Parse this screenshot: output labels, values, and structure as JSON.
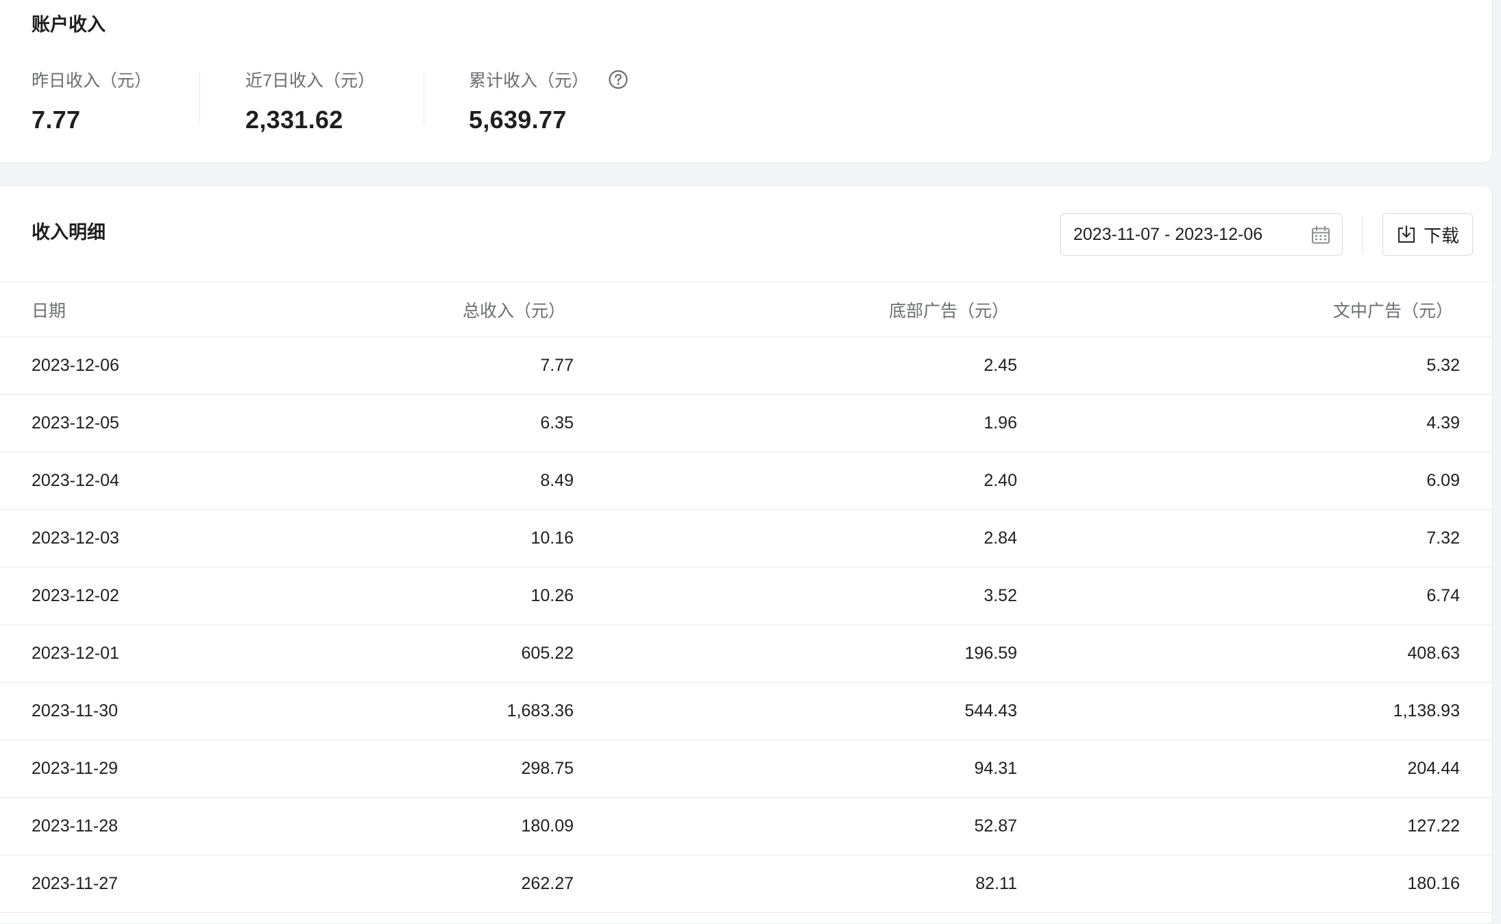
{
  "account": {
    "title": "账户收入",
    "metrics": [
      {
        "label": "昨日收入（元）",
        "value": "7.77"
      },
      {
        "label": "近7日收入（元）",
        "value": "2,331.62"
      },
      {
        "label": "累计收入（元）",
        "value": "5,639.77",
        "icon": "help-circle-icon"
      }
    ]
  },
  "detail": {
    "title": "收入明细",
    "date_range": "2023-11-07 - 2023-12-06",
    "download_label": "下载",
    "columns": [
      "日期",
      "总收入（元）",
      "底部广告（元）",
      "文中广告（元）"
    ],
    "rows": [
      [
        "2023-12-06",
        "7.77",
        "2.45",
        "5.32"
      ],
      [
        "2023-12-05",
        "6.35",
        "1.96",
        "4.39"
      ],
      [
        "2023-12-04",
        "8.49",
        "2.40",
        "6.09"
      ],
      [
        "2023-12-03",
        "10.16",
        "2.84",
        "7.32"
      ],
      [
        "2023-12-02",
        "10.26",
        "3.52",
        "6.74"
      ],
      [
        "2023-12-01",
        "605.22",
        "196.59",
        "408.63"
      ],
      [
        "2023-11-30",
        "1,683.36",
        "544.43",
        "1,138.93"
      ],
      [
        "2023-11-29",
        "298.75",
        "94.31",
        "204.44"
      ],
      [
        "2023-11-28",
        "180.09",
        "52.87",
        "127.22"
      ],
      [
        "2023-11-27",
        "262.27",
        "82.11",
        "180.16"
      ]
    ]
  }
}
